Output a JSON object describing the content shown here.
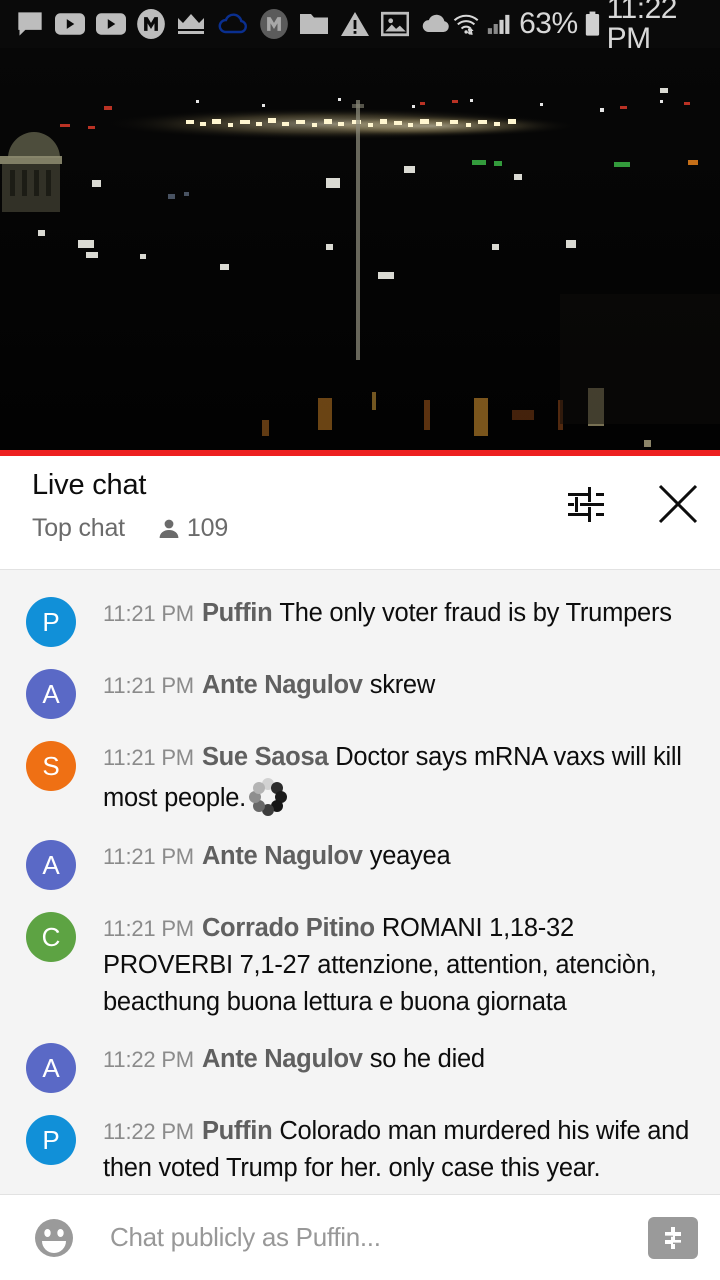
{
  "status_bar": {
    "left_icons": [
      {
        "name": "chat-bubble-icon",
        "label": "messages"
      },
      {
        "name": "youtube-play-icon",
        "label": "youtube"
      },
      {
        "name": "youtube-play-icon-2",
        "label": "youtube"
      },
      {
        "name": "m-circle-icon",
        "label": "m-app"
      },
      {
        "name": "crown-icon",
        "label": "crown"
      },
      {
        "name": "cloud-outline-icon",
        "label": "cloud-sync"
      },
      {
        "name": "m-circle-gray-icon",
        "label": "m-app-gray"
      },
      {
        "name": "folder-icon",
        "label": "folder"
      },
      {
        "name": "warning-triangle-icon",
        "label": "warning"
      },
      {
        "name": "image-icon",
        "label": "screenshot"
      },
      {
        "name": "cloud-filled-icon",
        "label": "cloud"
      }
    ],
    "wifi_icon": "wifi-icon",
    "signal_icon": "cellular-signal-icon",
    "battery_percent": "63%",
    "battery_icon": "battery-icon",
    "clock": "11:22 PM"
  },
  "video": {
    "progress_color": "#ed2020",
    "progress_percent": 100,
    "scene": "night cityscape with distant lights"
  },
  "chat_header": {
    "title": "Live chat",
    "mode": "Top chat",
    "viewer_icon": "person-icon",
    "viewer_count": "109",
    "settings_icon": "tune-sliders-icon",
    "close_icon": "close-icon"
  },
  "messages": [
    {
      "avatar_letter": "P",
      "avatar_color": "#1190d8",
      "time": "11:21 PM",
      "author": "Puffin",
      "text": "The only voter fraud is by Trumpers",
      "emoji": null
    },
    {
      "avatar_letter": "A",
      "avatar_color": "#5a69c6",
      "time": "11:21 PM",
      "author": "Ante Nagulov",
      "text": "skrew",
      "emoji": null
    },
    {
      "avatar_letter": "S",
      "avatar_color": "#ef7014",
      "time": "11:21 PM",
      "author": "Sue Saosa",
      "text": "Doctor says mRNA vaxs will kill most people.",
      "emoji": "loading-spinner-emoji"
    },
    {
      "avatar_letter": "A",
      "avatar_color": "#5a69c6",
      "time": "11:21 PM",
      "author": "Ante Nagulov",
      "text": "yeayea",
      "emoji": null
    },
    {
      "avatar_letter": "C",
      "avatar_color": "#5da343",
      "time": "11:21 PM",
      "author": "Corrado Pitino",
      "text": "ROMANI 1,18-32 PROVERBI 7,1-27 attenzione, attention, atenciòn, beacthung buona lettura e buona giornata",
      "emoji": null
    },
    {
      "avatar_letter": "A",
      "avatar_color": "#5a69c6",
      "time": "11:22 PM",
      "author": "Ante Nagulov",
      "text": "so he died",
      "emoji": null
    },
    {
      "avatar_letter": "P",
      "avatar_color": "#1190d8",
      "time": "11:22 PM",
      "author": "Puffin",
      "text": "Colorado man murdered his wife and then voted Trump for her. only case this year.",
      "emoji": null
    }
  ],
  "input_bar": {
    "emoji_icon": "emoji-smiley-icon",
    "placeholder": "Chat publicly as Puffin...",
    "input_value": "",
    "superchat_icon": "dollar-sign-icon"
  }
}
